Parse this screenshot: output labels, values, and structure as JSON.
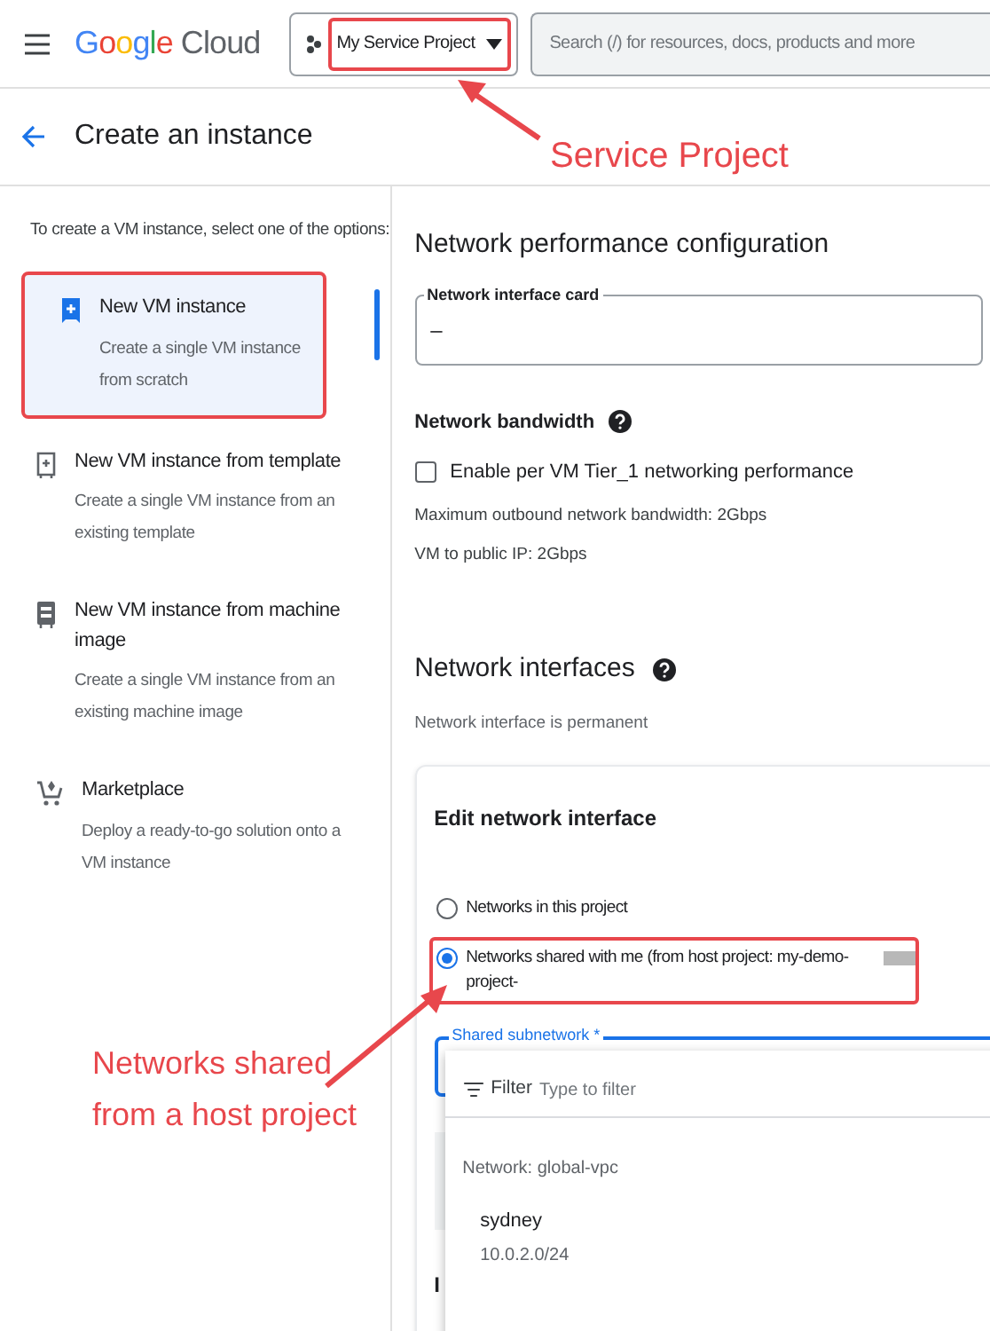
{
  "header": {
    "logo": "Google Cloud",
    "project_selector": "My Service Project",
    "search": {
      "placeholder": "Search (/) for resources, docs, products and more"
    }
  },
  "page_title": "Create an instance",
  "sidebar": {
    "intro": "To create a VM instance, select one of the options:",
    "items": [
      {
        "kind": "new",
        "title": "New VM instance",
        "description": "Create a single VM instance from scratch",
        "selected": true
      },
      {
        "kind": "template",
        "title": "New VM instance from template",
        "description": "Create a single VM instance from an existing template",
        "selected": false
      },
      {
        "kind": "machine-image",
        "title": "New VM instance from machine image",
        "description": "Create a single VM instance from an existing machine image",
        "selected": false
      },
      {
        "kind": "marketplace",
        "title": "Marketplace",
        "description": "Deploy a ready-to-go solution onto a VM instance",
        "selected": false
      }
    ]
  },
  "performance": {
    "title": "Network performance configuration",
    "nic_label": "Network interface card",
    "nic_value": "–",
    "bandwidth_label": "Network bandwidth",
    "tier1": {
      "label": "Enable per VM Tier_1 networking performance",
      "checked": false
    },
    "max_outbound": "Maximum outbound network bandwidth: 2Gbps",
    "public_ip": "VM to public IP: 2Gbps"
  },
  "interfaces": {
    "title": "Network interfaces",
    "note": "Network interface is permanent",
    "card_title": "Edit network interface",
    "options": [
      {
        "label": "Networks in this project",
        "selected": false
      },
      {
        "label": "Networks shared with me (from host project: my-demo-project-",
        "selected": true
      }
    ],
    "subnet_label": "Shared subnetwork *",
    "filter": {
      "label": "Filter",
      "placeholder": "Type to filter"
    },
    "network": "Network: global-vpc",
    "subnet": {
      "name": "sydney",
      "range": "10.0.2.0/24"
    },
    "partial_label": "I"
  },
  "annotations": [
    {
      "text": "Service Project"
    },
    {
      "text": "Networks shared from a host project"
    }
  ]
}
